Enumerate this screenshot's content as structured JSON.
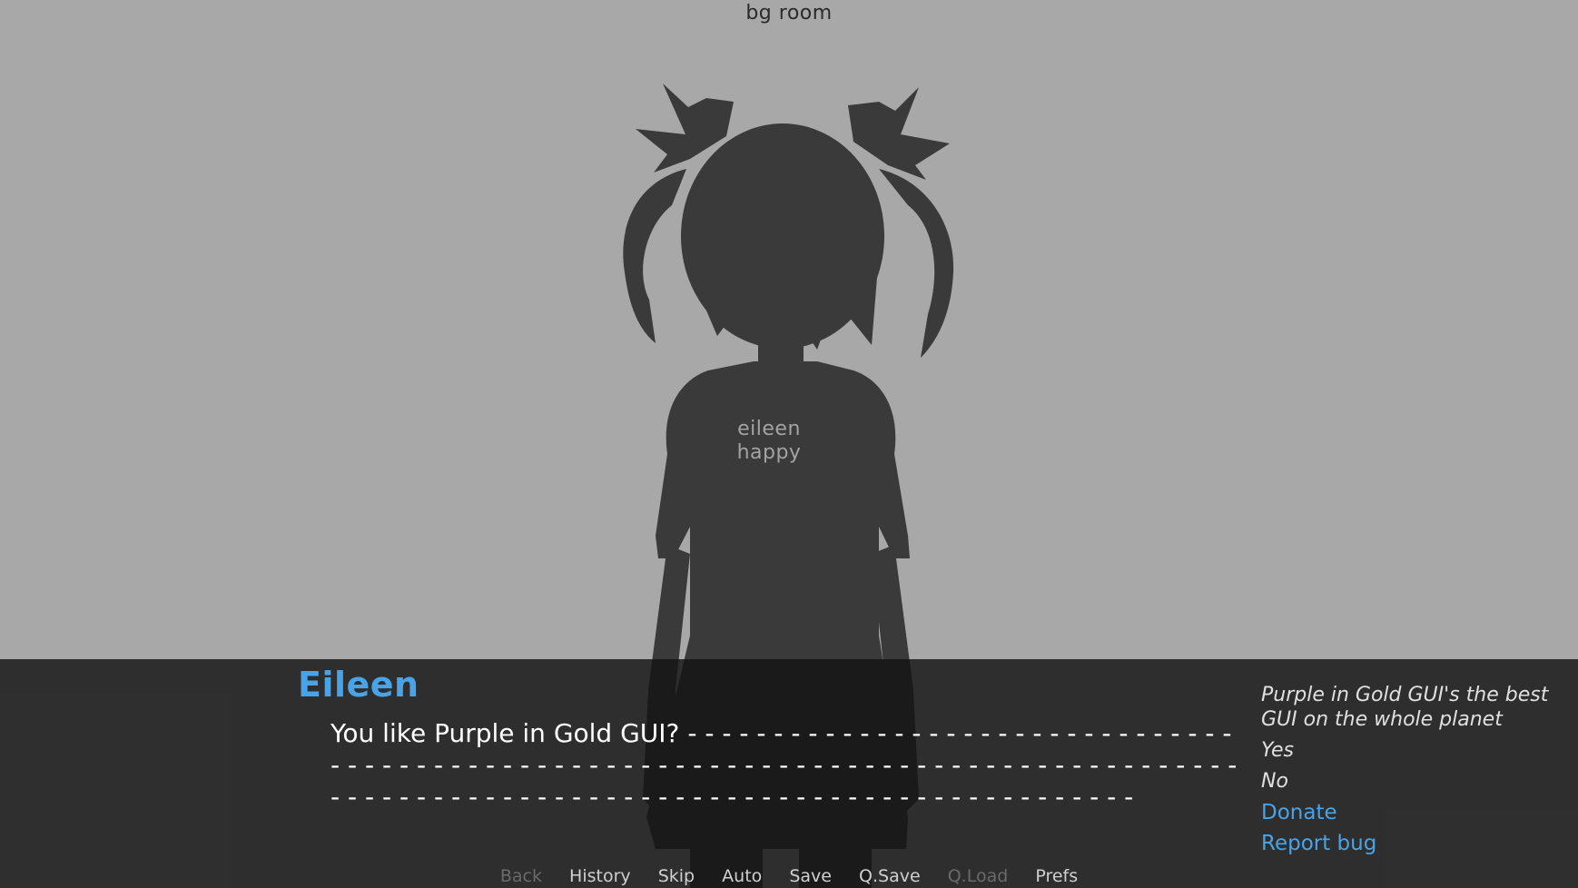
{
  "scene": {
    "background_label": "bg room",
    "sprite_label_line1": "eileen",
    "sprite_label_line2": "happy"
  },
  "dialogue": {
    "speaker": "Eileen",
    "text": "You like Purple in Gold GUI? - - - - - - - - - - - - - - - - - - - - - - - - - - - - - - - - - - - - - - - - - - - - - - - - - - - - - - - - - - - - - - - - - - - - - - - - - - - - - - - - - - - - - - - - - - - - - - - - - - - - - - - - - - - - - - - - - - - - - - - - - - - - - - - - - - - -"
  },
  "side_menu": {
    "caption": "Purple in Gold GUI's the best GUI on the whole planet",
    "options": [
      "Yes",
      "No"
    ],
    "links": [
      "Donate",
      "Report bug"
    ]
  },
  "quick_menu": {
    "back": "Back",
    "history": "History",
    "skip": "Skip",
    "auto": "Auto",
    "save": "Save",
    "qsave": "Q.Save",
    "qload": "Q.Load",
    "prefs": "Prefs"
  },
  "colors": {
    "background": "#a8a8a8",
    "silhouette": "#3a3a3a",
    "accent": "#4aa3e6",
    "disabled": "#6a6a6a"
  }
}
